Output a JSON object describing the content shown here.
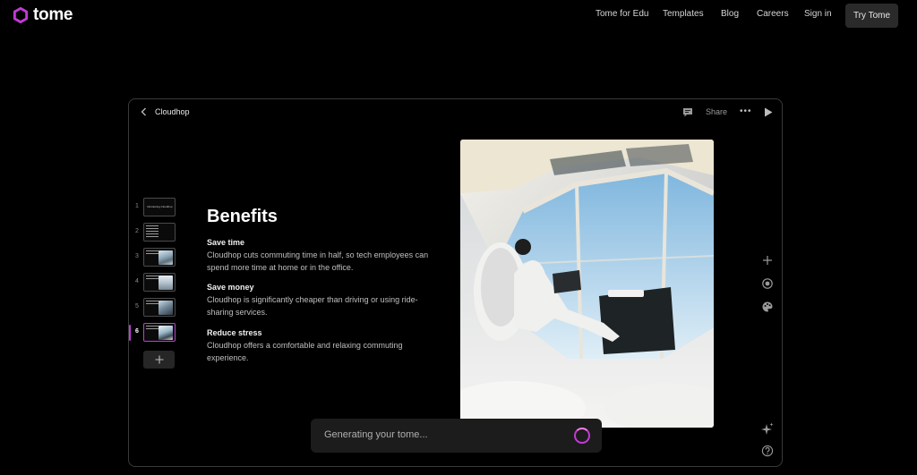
{
  "brand": {
    "name": "tome",
    "accent": "#c13bd6"
  },
  "nav": {
    "links": [
      "Tome for Edu",
      "Templates",
      "Blog",
      "Careers",
      "Sign in"
    ],
    "cta": "Try Tome"
  },
  "editor": {
    "doc_title": "Cloudhop",
    "share_label": "Share",
    "more_label": "•••",
    "thumbnails": [
      {
        "num": "1",
        "text": "Introducing Cloudhop"
      },
      {
        "num": "2"
      },
      {
        "num": "3"
      },
      {
        "num": "4"
      },
      {
        "num": "5"
      },
      {
        "num": "6",
        "active": true
      }
    ],
    "slide": {
      "title": "Benefits",
      "sections": [
        {
          "heading": "Save time",
          "body": "Cloudhop cuts commuting time in half, so tech employees can spend more time at home or in the office."
        },
        {
          "heading": "Save money",
          "body": "Cloudhop is significantly cheaper than driving or using ride-sharing services."
        },
        {
          "heading": "Reduce stress",
          "body": "Cloudhop offers a comfortable and relaxing commuting experience."
        }
      ]
    },
    "generating_text": "Generating your tome...",
    "icons": [
      "back-icon",
      "comment-icon",
      "more-icon",
      "play-icon",
      "add-icon",
      "record-icon",
      "palette-icon",
      "sparkle-icon",
      "help-icon"
    ]
  }
}
